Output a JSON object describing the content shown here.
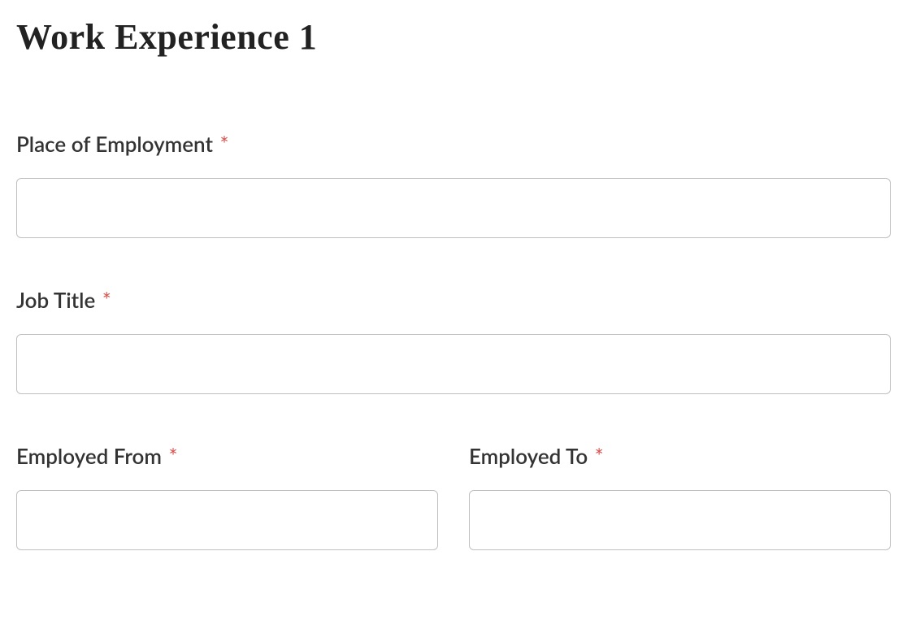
{
  "section": {
    "title": "Work Experience 1"
  },
  "fields": {
    "place_of_employment": {
      "label": "Place of Employment",
      "required_mark": "*",
      "value": ""
    },
    "job_title": {
      "label": "Job Title",
      "required_mark": "*",
      "value": ""
    },
    "employed_from": {
      "label": "Employed From",
      "required_mark": "*",
      "value": ""
    },
    "employed_to": {
      "label": "Employed To",
      "required_mark": "*",
      "value": ""
    }
  }
}
